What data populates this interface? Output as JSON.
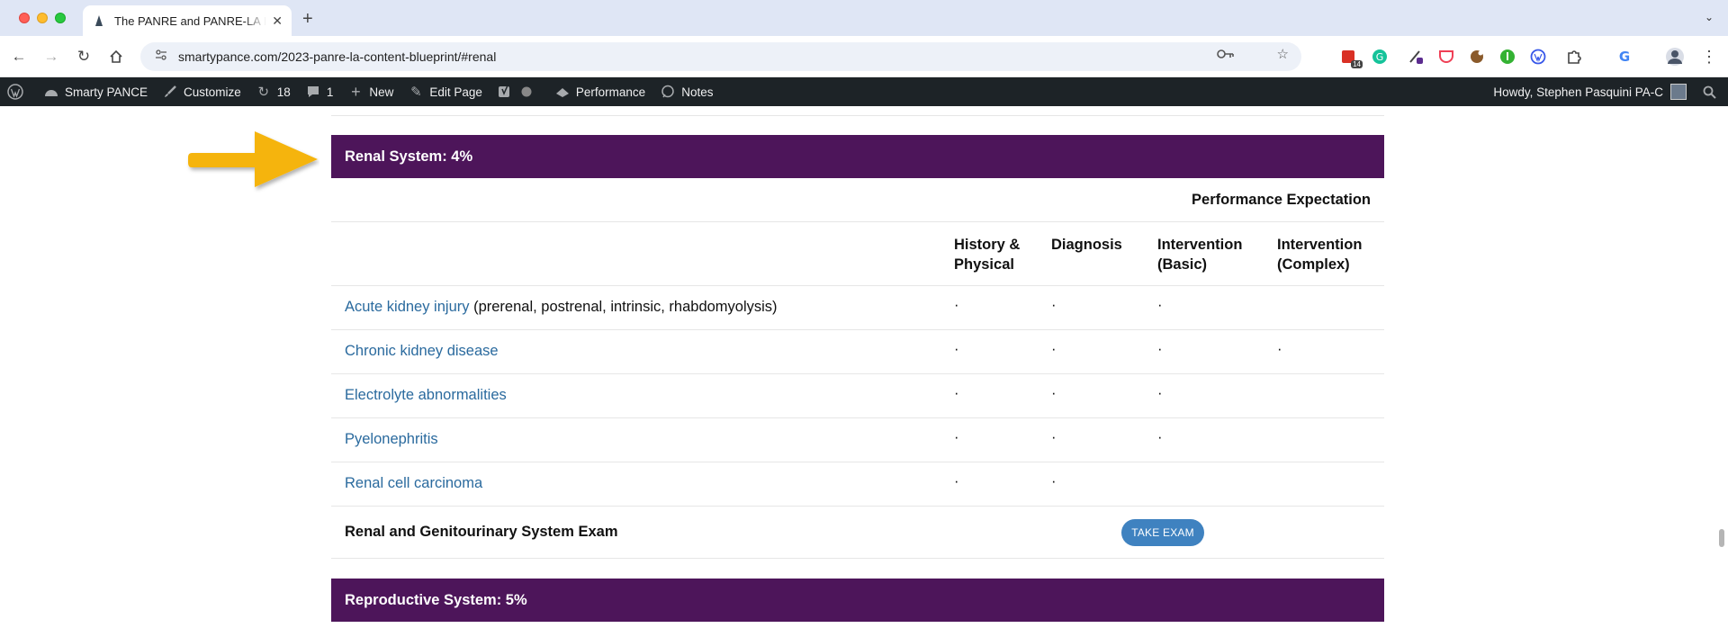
{
  "browser": {
    "tab_title": "The PANRE and PANRE-LA In",
    "url": "smartypance.com/2023-panre-la-content-blueprint/#renal",
    "ext_badge": "14"
  },
  "wpbar": {
    "site_name": "Smarty PANCE",
    "customize": "Customize",
    "updates_count": "18",
    "comments_count": "1",
    "new": "New",
    "edit_page": "Edit Page",
    "performance": "Performance",
    "notes": "Notes",
    "howdy": "Howdy, Stephen Pasquini PA-C"
  },
  "renal": {
    "header": "Renal System: 4%",
    "perf_expectation": "Performance Expectation",
    "columns": [
      "History & Physical",
      "Diagnosis",
      "Intervention (Basic)",
      "Intervention (Complex)"
    ],
    "rows": [
      {
        "link": "Acute kidney injury",
        "extra": " (prerenal, postrenal, intrinsic, rhabdomyolysis)",
        "marks": [
          "·",
          "·",
          "·",
          ""
        ]
      },
      {
        "link": "Chronic kidney disease",
        "extra": "",
        "marks": [
          "·",
          "·",
          "·",
          "·"
        ]
      },
      {
        "link": "Electrolyte abnormalities",
        "extra": "",
        "marks": [
          "·",
          "·",
          "·",
          ""
        ]
      },
      {
        "link": "Pyelonephritis",
        "extra": "",
        "marks": [
          "·",
          "·",
          "·",
          ""
        ]
      },
      {
        "link": "Renal cell carcinoma",
        "extra": "",
        "marks": [
          "·",
          "·",
          "",
          ""
        ]
      }
    ],
    "exam_title": "Renal and Genitourinary System Exam",
    "exam_button": "TAKE EXAM"
  },
  "reproductive": {
    "header": "Reproductive System: 5%"
  },
  "colors": {
    "section_header": "#4d155a",
    "link": "#2a6a9e",
    "exam_button": "#3f82c0",
    "arrow": "#f5b40a"
  }
}
